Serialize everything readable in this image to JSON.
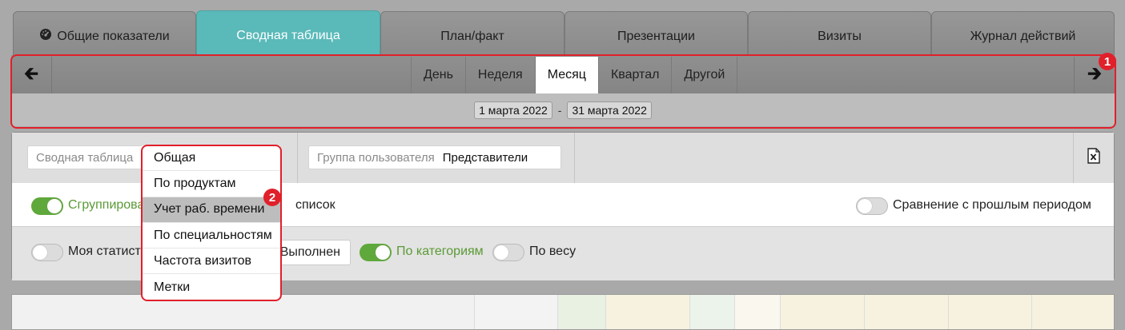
{
  "tabs": [
    {
      "label": "Общие показатели",
      "icon": "gauge-icon"
    },
    {
      "label": "Сводная таблица",
      "active": true
    },
    {
      "label": "План/факт"
    },
    {
      "label": "Презентации"
    },
    {
      "label": "Визиты"
    },
    {
      "label": "Журнал действий"
    }
  ],
  "period": {
    "prev_icon": "arrow-left-icon",
    "next_icon": "arrow-right-icon",
    "options": [
      "День",
      "Неделя",
      "Месяц",
      "Квартал",
      "Другой"
    ],
    "selected": "Месяц",
    "date_from": "1 марта 2022",
    "date_sep": "-",
    "date_to": "31 марта 2022"
  },
  "filters": {
    "pivot_label": "Сводная таблица",
    "group_label": "Группа пользователя",
    "group_value": "Представители",
    "export_icon": "excel-export-icon",
    "grouped_label": "Сгруппирова",
    "list_suffix": "список",
    "compare_label": "Сравнение с прошлым периодом",
    "my_stats_label": "Моя статисти",
    "done_button": "Выполнен",
    "by_category_label": "По категориям",
    "by_weight_label": "По весу"
  },
  "dropdown": {
    "items": [
      "Общая",
      "По продуктам",
      "Учет раб. времени",
      "По специальностям",
      "Частота визитов",
      "Метки"
    ],
    "highlighted": "Учет раб. времени"
  },
  "markers": [
    "1",
    "2"
  ],
  "colors": {
    "active_tab": "#5ab9b9",
    "toggle_on": "#5fa83b",
    "marker": "#e0202a"
  }
}
